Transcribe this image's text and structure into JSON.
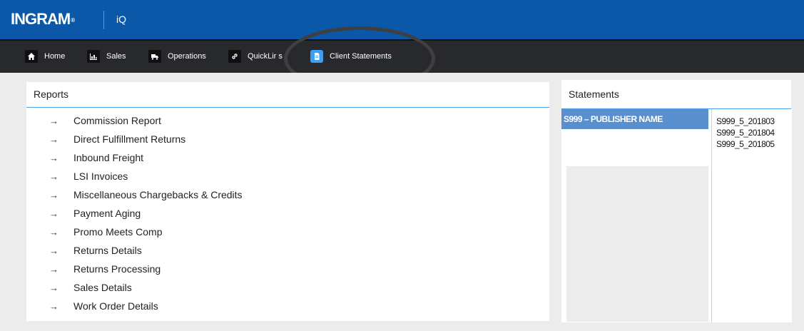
{
  "header": {
    "logo_text": "INGRAM",
    "logo_mark": "®",
    "app_name": "iQ"
  },
  "nav": {
    "items": [
      {
        "label": "Home",
        "icon": "home-icon"
      },
      {
        "label": "Sales",
        "icon": "chart-icon"
      },
      {
        "label": "Operations",
        "icon": "truck-icon"
      },
      {
        "label": "QuickLir  s",
        "icon": "link-icon"
      },
      {
        "label": "Client Statements",
        "icon": "document-icon"
      }
    ]
  },
  "reports": {
    "title": "Reports",
    "items": [
      "Commission Report",
      "Direct Fulfillment Returns",
      "Inbound Freight",
      "LSI Invoices",
      "Miscellaneous Chargebacks & Credits",
      "Payment Aging",
      "Promo Meets Comp",
      "Returns Details",
      "Returns Processing",
      "Sales Details",
      "Work Order Details"
    ],
    "arrow": "→"
  },
  "statements": {
    "title": "Statements",
    "publisher": "S999 – PUBLISHER NAME",
    "files": [
      "S999_5_201803",
      "S999_5_201804",
      "S999_5_201805"
    ]
  },
  "colors": {
    "header_blue": "#0b57a8",
    "nav_dark": "#27292c",
    "accent_blue": "#4b9be6",
    "selected_row": "#5a8fcd"
  }
}
